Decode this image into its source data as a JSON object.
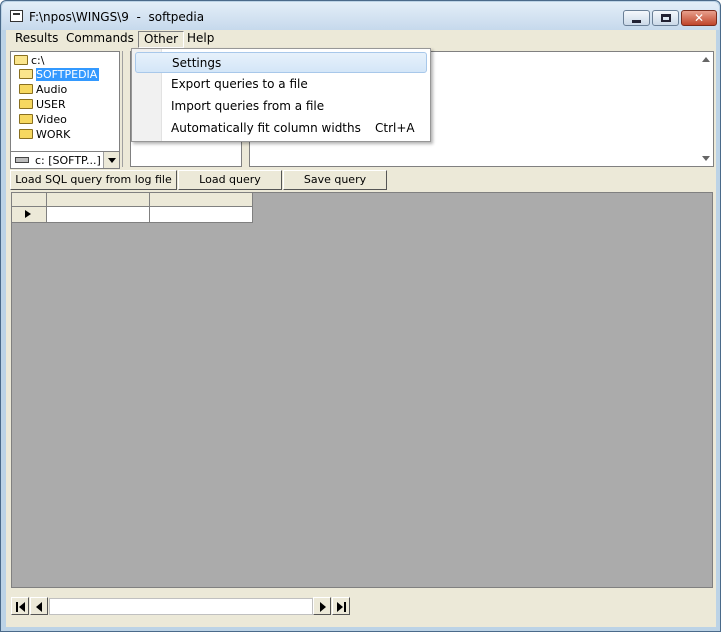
{
  "window": {
    "title": "F:\\npos\\WINGS\\9  -  softpedia"
  },
  "menubar": {
    "items": [
      "Results",
      "Commands",
      "Other",
      "Help"
    ],
    "open_menu": "Other"
  },
  "other_menu": {
    "items": [
      {
        "label": "Settings",
        "shortcut": ""
      },
      {
        "label": "Export queries to a file",
        "shortcut": ""
      },
      {
        "label": "Import queries from a file",
        "shortcut": ""
      },
      {
        "label": "Automatically fit column widths",
        "shortcut": "Ctrl+A"
      }
    ],
    "highlighted": "Settings"
  },
  "tree": {
    "items": [
      {
        "label": "c:\\",
        "depth": 0
      },
      {
        "label": "SOFTPEDIA",
        "depth": 1,
        "selected": true
      },
      {
        "label": "Audio",
        "depth": 2
      },
      {
        "label": "USER",
        "depth": 2
      },
      {
        "label": "Video",
        "depth": 2
      },
      {
        "label": "WORK",
        "depth": 2
      }
    ]
  },
  "drive_combo": {
    "value": "c: [SOFTP...]"
  },
  "buttons": {
    "load_log": "Load SQL query from log file",
    "load": "Load query",
    "save": "Save query"
  }
}
